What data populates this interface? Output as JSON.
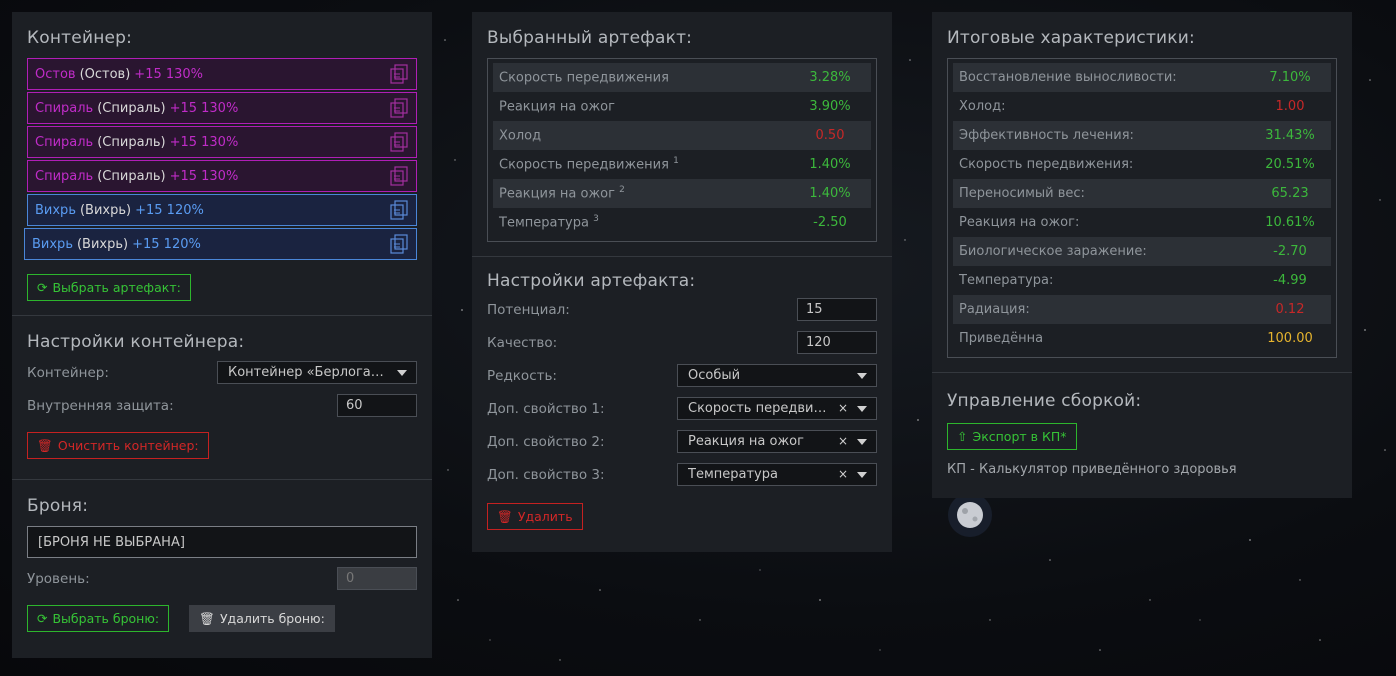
{
  "left": {
    "container_title": "Контейнер:",
    "slots": [
      {
        "name": "Остов",
        "paren": "(Остов)",
        "level": "+15 130%",
        "color": "magenta"
      },
      {
        "name": "Спираль",
        "paren": "(Спираль)",
        "level": "+15 130%",
        "color": "magenta"
      },
      {
        "name": "Спираль",
        "paren": "(Спираль)",
        "level": "+15 130%",
        "color": "magenta"
      },
      {
        "name": "Спираль",
        "paren": "(Спираль)",
        "level": "+15 130%",
        "color": "magenta"
      },
      {
        "name": "Вихрь",
        "paren": "(Вихрь)",
        "level": "+15 120%",
        "color": "blue"
      },
      {
        "name": "Вихрь",
        "paren": "(Вихрь)",
        "level": "+15 120%",
        "color": "blue"
      }
    ],
    "select_artifact_btn": "Выбрать артефакт:",
    "settings_title": "Настройки контейнера:",
    "container_label": "Контейнер:",
    "container_value": "Контейнер «Берлога…",
    "inner_protection_label": "Внутренняя защита:",
    "inner_protection_value": "60",
    "clear_btn": "Очистить контейнер:",
    "armor_title": "Броня:",
    "armor_value": "[БРОНЯ НЕ ВЫБРАНА]",
    "level_label": "Уровень:",
    "level_value": "0",
    "select_armor_btn": "Выбрать броню:",
    "delete_armor_btn": "Удалить броню:"
  },
  "middle": {
    "selected_title": "Выбранный артефакт:",
    "stats": [
      {
        "label": "Скорость передвижения",
        "sup": "",
        "value": "3.28%",
        "type": "pos"
      },
      {
        "label": "Реакция на ожог",
        "sup": "",
        "value": "3.90%",
        "type": "pos"
      },
      {
        "label": "Холод",
        "sup": "",
        "value": "0.50",
        "type": "neg"
      },
      {
        "label": "Скорость передвижения",
        "sup": "1",
        "value": "1.40%",
        "type": "pos"
      },
      {
        "label": "Реакция на ожог",
        "sup": "2",
        "value": "1.40%",
        "type": "pos"
      },
      {
        "label": "Температура",
        "sup": "3",
        "value": "-2.50",
        "type": "pos"
      }
    ],
    "settings_title": "Настройки артефакта:",
    "potential_label": "Потенциал:",
    "potential_value": "15",
    "quality_label": "Качество:",
    "quality_value": "120",
    "rarity_label": "Редкость:",
    "rarity_value": "Особый",
    "extra1_label": "Доп. свойство 1:",
    "extra1_value": "Скорость передви…",
    "extra2_label": "Доп. свойство 2:",
    "extra2_value": "Реакция на ожог",
    "extra3_label": "Доп. свойство 3:",
    "extra3_value": "Температура",
    "clear_symbol": "×",
    "delete_btn": "Удалить"
  },
  "right": {
    "total_title": "Итоговые характеристики:",
    "stats": [
      {
        "label": "Восстановление выносливости:",
        "value": "7.10%",
        "type": "pos"
      },
      {
        "label": "Холод:",
        "value": "1.00",
        "type": "neg"
      },
      {
        "label": "Эффективность лечения:",
        "value": "31.43%",
        "type": "pos"
      },
      {
        "label": "Скорость передвижения:",
        "value": "20.51%",
        "type": "pos"
      },
      {
        "label": "Переносимый вес:",
        "value": "65.23",
        "type": "pos"
      },
      {
        "label": "Реакция на ожог:",
        "value": "10.61%",
        "type": "pos"
      },
      {
        "label": "Биологическое заражение:",
        "value": "-2.70",
        "type": "pos"
      },
      {
        "label": "Температура:",
        "value": "-4.99",
        "type": "pos"
      },
      {
        "label": "Радиация:",
        "value": "0.12",
        "type": "neg"
      },
      {
        "label": "Приведённа",
        "value": "100.00",
        "type": "gold"
      }
    ],
    "build_title": "Управление сборкой:",
    "export_btn": "Экспорт в КП*",
    "note": "КП - Калькулятор приведённого здоровья"
  },
  "colors": {
    "panel_bg": "#1c1f24",
    "green": "#36c336",
    "red": "#d22727",
    "magenta": "#c02cc8",
    "blue": "#5a9cf2",
    "gold": "#e6b42e"
  }
}
